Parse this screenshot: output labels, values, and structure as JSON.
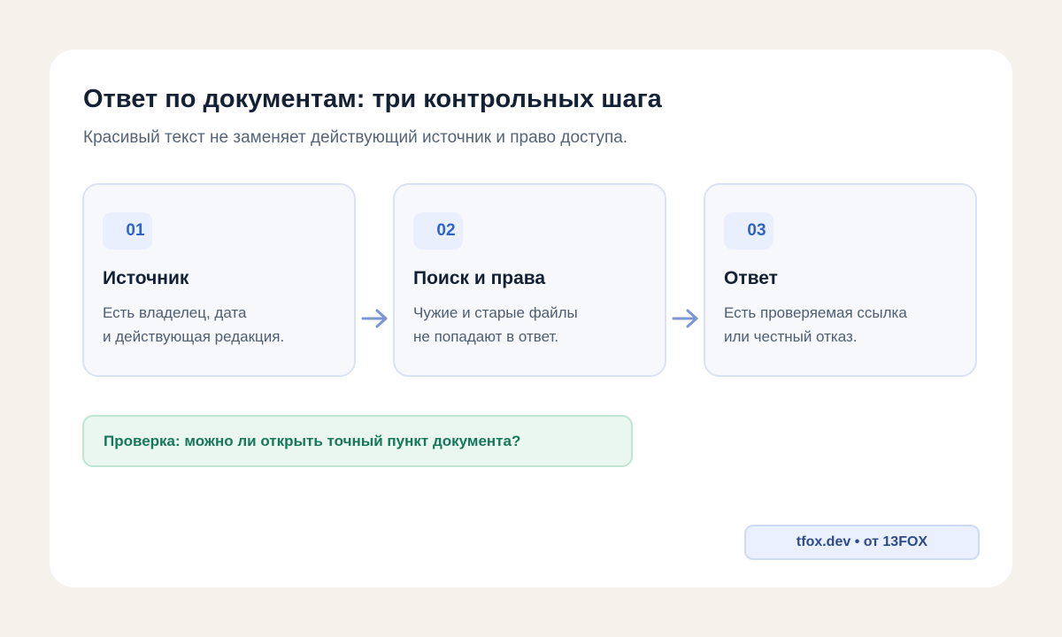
{
  "header": {
    "title": "Ответ по документам: три контрольных шага",
    "subtitle": "Красивый текст не заменяет действующий источник и право доступа."
  },
  "steps": [
    {
      "number": "01",
      "title": "Источник",
      "lines": [
        "Есть владелец, дата",
        "и действующая редакция."
      ]
    },
    {
      "number": "02",
      "title": "Поиск и права",
      "lines": [
        "Чужие и старые файлы",
        "не попадают в ответ."
      ]
    },
    {
      "number": "03",
      "title": "Ответ",
      "lines": [
        "Есть проверяемая ссылка",
        "или честный отказ."
      ]
    }
  ],
  "arrows": [
    {
      "icon": "arrow-right-icon"
    },
    {
      "icon": "arrow-right-icon"
    }
  ],
  "check": {
    "text": "Проверка: можно ли открыть точный пункт документа?"
  },
  "footer": {
    "badge": "tfox.dev • от 13FOX"
  },
  "colors": {
    "background": "#f4f2ea",
    "card": "#ffffff",
    "accent": "#2f63c8",
    "arrow": "#7b97cf",
    "check_text": "#17775a",
    "check_bg": "#eaf7f1"
  }
}
